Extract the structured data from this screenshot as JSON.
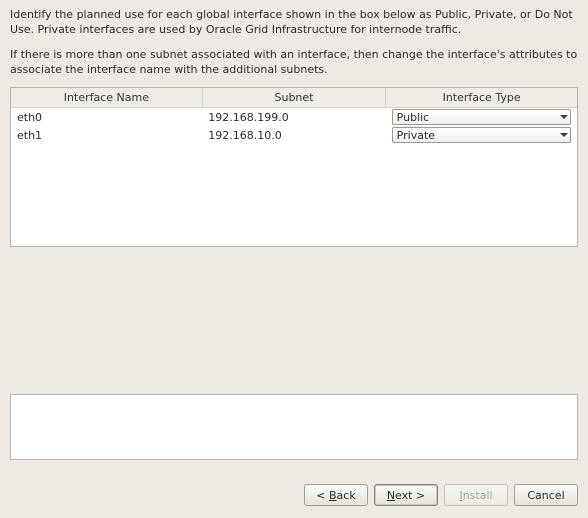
{
  "intro": {
    "p1": "Identify the planned use for each global interface shown in the box below as Public, Private, or Do Not Use. Private interfaces are used by Oracle Grid Infrastructure for internode traffic.",
    "p2": "If there is more than one subnet associated with an interface, then change the interface's attributes to associate the interface name with the additional subnets."
  },
  "table": {
    "headers": {
      "name": "Interface Name",
      "subnet": "Subnet",
      "type": "Interface Type"
    },
    "rows": [
      {
        "name": "eth0",
        "subnet": "192.168.199.0",
        "type": "Public"
      },
      {
        "name": "eth1",
        "subnet": "192.168.10.0",
        "type": "Private"
      }
    ]
  },
  "buttons": {
    "back": "< Back",
    "next": "Next >",
    "install": "Install",
    "cancel": "Cancel"
  }
}
